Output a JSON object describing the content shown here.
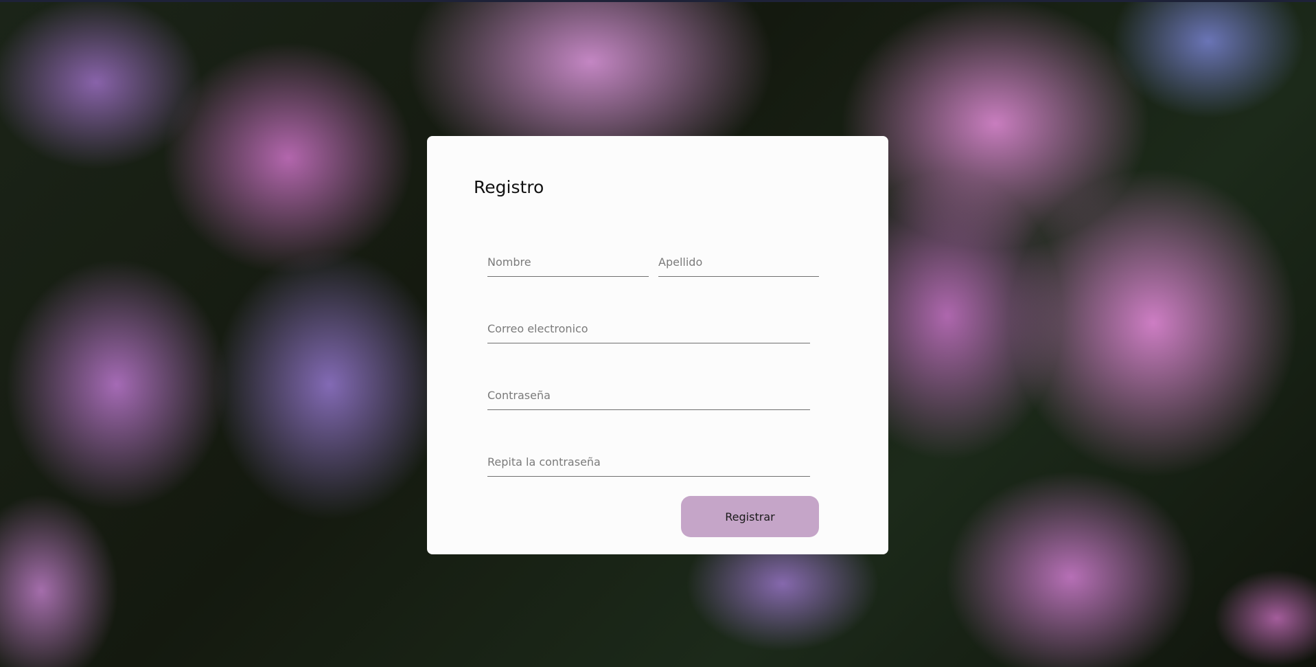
{
  "page": {
    "background_image": "hydrangea-flowers-photo"
  },
  "form": {
    "title": "Registro",
    "fields": {
      "nombre": {
        "value": "",
        "placeholder": "Nombre"
      },
      "apellido": {
        "value": "",
        "placeholder": "Apellido"
      },
      "correo": {
        "value": "",
        "placeholder": "Correo electronico"
      },
      "password": {
        "value": "",
        "placeholder": "Contraseña"
      },
      "password_repeat": {
        "value": "",
        "placeholder": "Repita la contraseña"
      }
    },
    "submit_label": "Registrar"
  },
  "colors": {
    "card_background": "#fcfcfc",
    "button_background": "#c5a5c8",
    "input_underline": "#6f6f6f",
    "placeholder_text": "#7a7a7a"
  }
}
